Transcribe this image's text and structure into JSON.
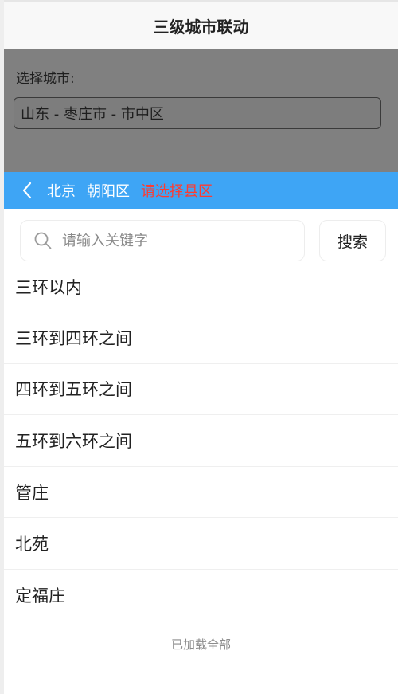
{
  "header": {
    "title": "三级城市联动"
  },
  "city_picker": {
    "label": "选择城市:",
    "value": "山东 - 枣庄市 - 市中区"
  },
  "breadcrumb": {
    "back_icon": "chevron-left-icon",
    "items": [
      {
        "label": "北京"
      },
      {
        "label": "朝阳区"
      }
    ],
    "current": "请选择县区"
  },
  "search": {
    "icon": "search-icon",
    "placeholder": "请输入关键字",
    "value": "",
    "button_label": "搜索"
  },
  "districts": [
    {
      "label": "三环以内"
    },
    {
      "label": "三环到四环之间"
    },
    {
      "label": "四环到五环之间"
    },
    {
      "label": "五环到六环之间"
    },
    {
      "label": "管庄"
    },
    {
      "label": "北苑"
    },
    {
      "label": "定福庄"
    }
  ],
  "footer": {
    "status": "已加载全部"
  },
  "colors": {
    "accent": "#3ea5f5",
    "current_crumb": "#ff3b30",
    "overlay": "#808080"
  }
}
